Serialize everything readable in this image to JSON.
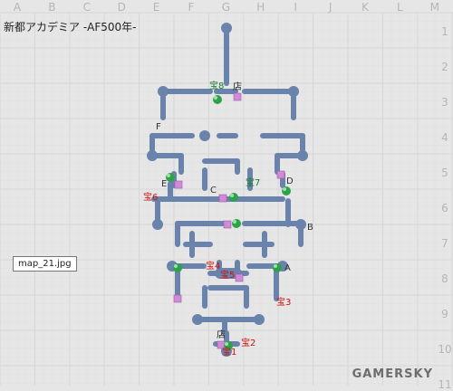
{
  "sheet": {
    "title": "新都アカデミア -AF500年-",
    "columns": [
      "A",
      "B",
      "C",
      "D",
      "E",
      "F",
      "G",
      "H",
      "I",
      "J",
      "K",
      "L",
      "M"
    ],
    "rows": [
      "1",
      "2",
      "3",
      "4",
      "5",
      "6",
      "7",
      "8",
      "9",
      "10",
      "11"
    ],
    "file_label": "map_21.jpg",
    "watermark": "GAMERSKY"
  },
  "colors": {
    "corridor": "#6a83ac",
    "grid": "#d3d3d3",
    "treasure_label": "#cc1111",
    "shop_label": "#222222",
    "point_label": "#333333",
    "door": "#d08ad8",
    "marker": "#2ea24a"
  },
  "map": {
    "points": [
      "A",
      "B",
      "C",
      "D",
      "E",
      "F"
    ],
    "treasures": [
      "宝1",
      "宝2",
      "宝3",
      "宝4",
      "宝5",
      "宝6",
      "宝7",
      "宝8"
    ],
    "shops": [
      "店",
      "店"
    ],
    "legend_icons": [
      "corridor",
      "door-square",
      "treasure-marker"
    ]
  }
}
